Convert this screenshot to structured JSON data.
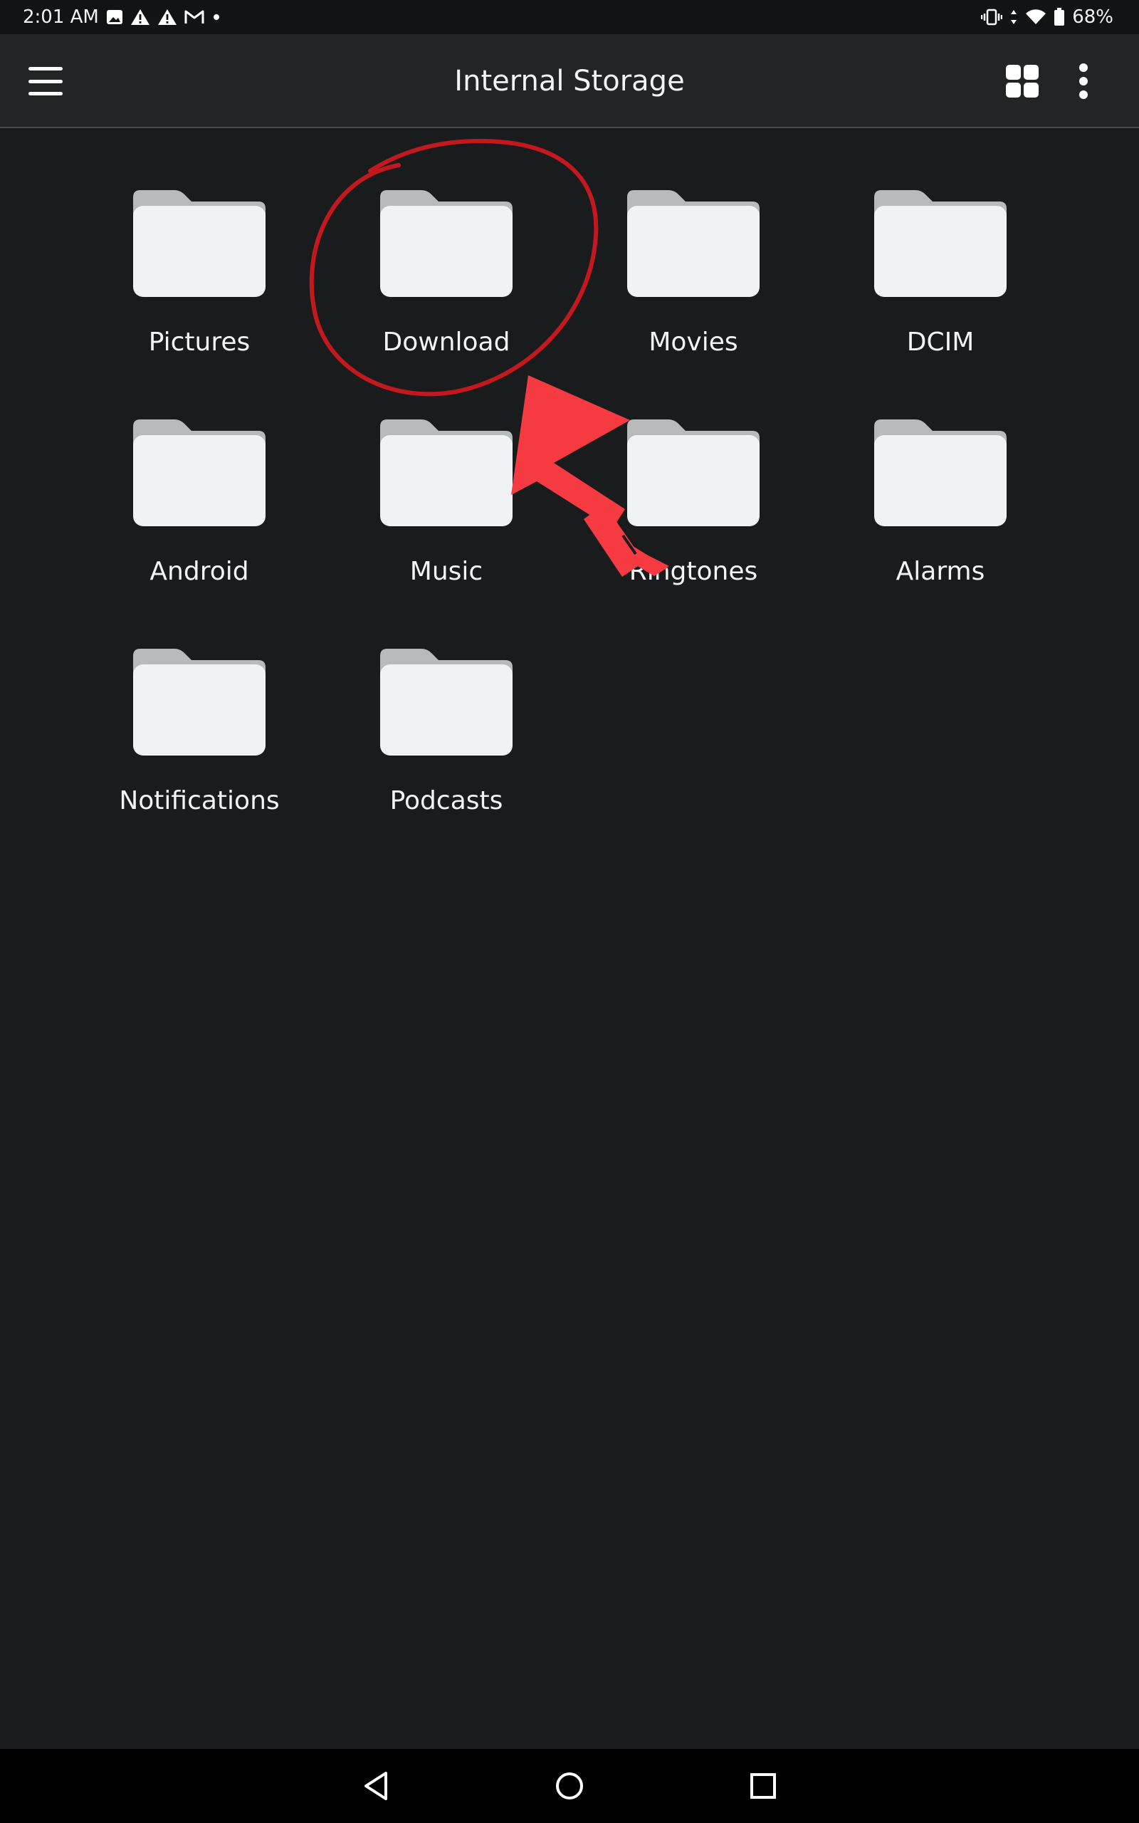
{
  "status_bar": {
    "time": "2:01 AM",
    "battery": "68%",
    "left_icons": [
      "image-icon",
      "alert-icon",
      "alert-icon",
      "gmail-icon",
      "dot-icon"
    ],
    "right_icons": [
      "vibrate-icon",
      "data-arrows-icon",
      "wifi-icon",
      "battery-icon"
    ]
  },
  "app_bar": {
    "title": "Internal Storage",
    "menu_icon": "hamburger-menu-icon",
    "view_icon": "grid-view-icon",
    "more_icon": "more-vert-icon"
  },
  "folders": [
    {
      "label": "Pictures"
    },
    {
      "label": "Download"
    },
    {
      "label": "Movies"
    },
    {
      "label": "DCIM"
    },
    {
      "label": "Android"
    },
    {
      "label": "Music"
    },
    {
      "label": "Ringtones"
    },
    {
      "label": "Alarms"
    },
    {
      "label": "Notifications"
    },
    {
      "label": "Podcasts"
    }
  ],
  "nav_bar": {
    "icons": [
      "back-triangle-icon",
      "home-circle-icon",
      "recents-square-icon"
    ]
  },
  "colors": {
    "background": "#1a1b1d",
    "app_bar": "#232426",
    "folder_back": "#b9babc",
    "folder_front": "#f1f2f6",
    "annotation_red": "#e8313a"
  }
}
